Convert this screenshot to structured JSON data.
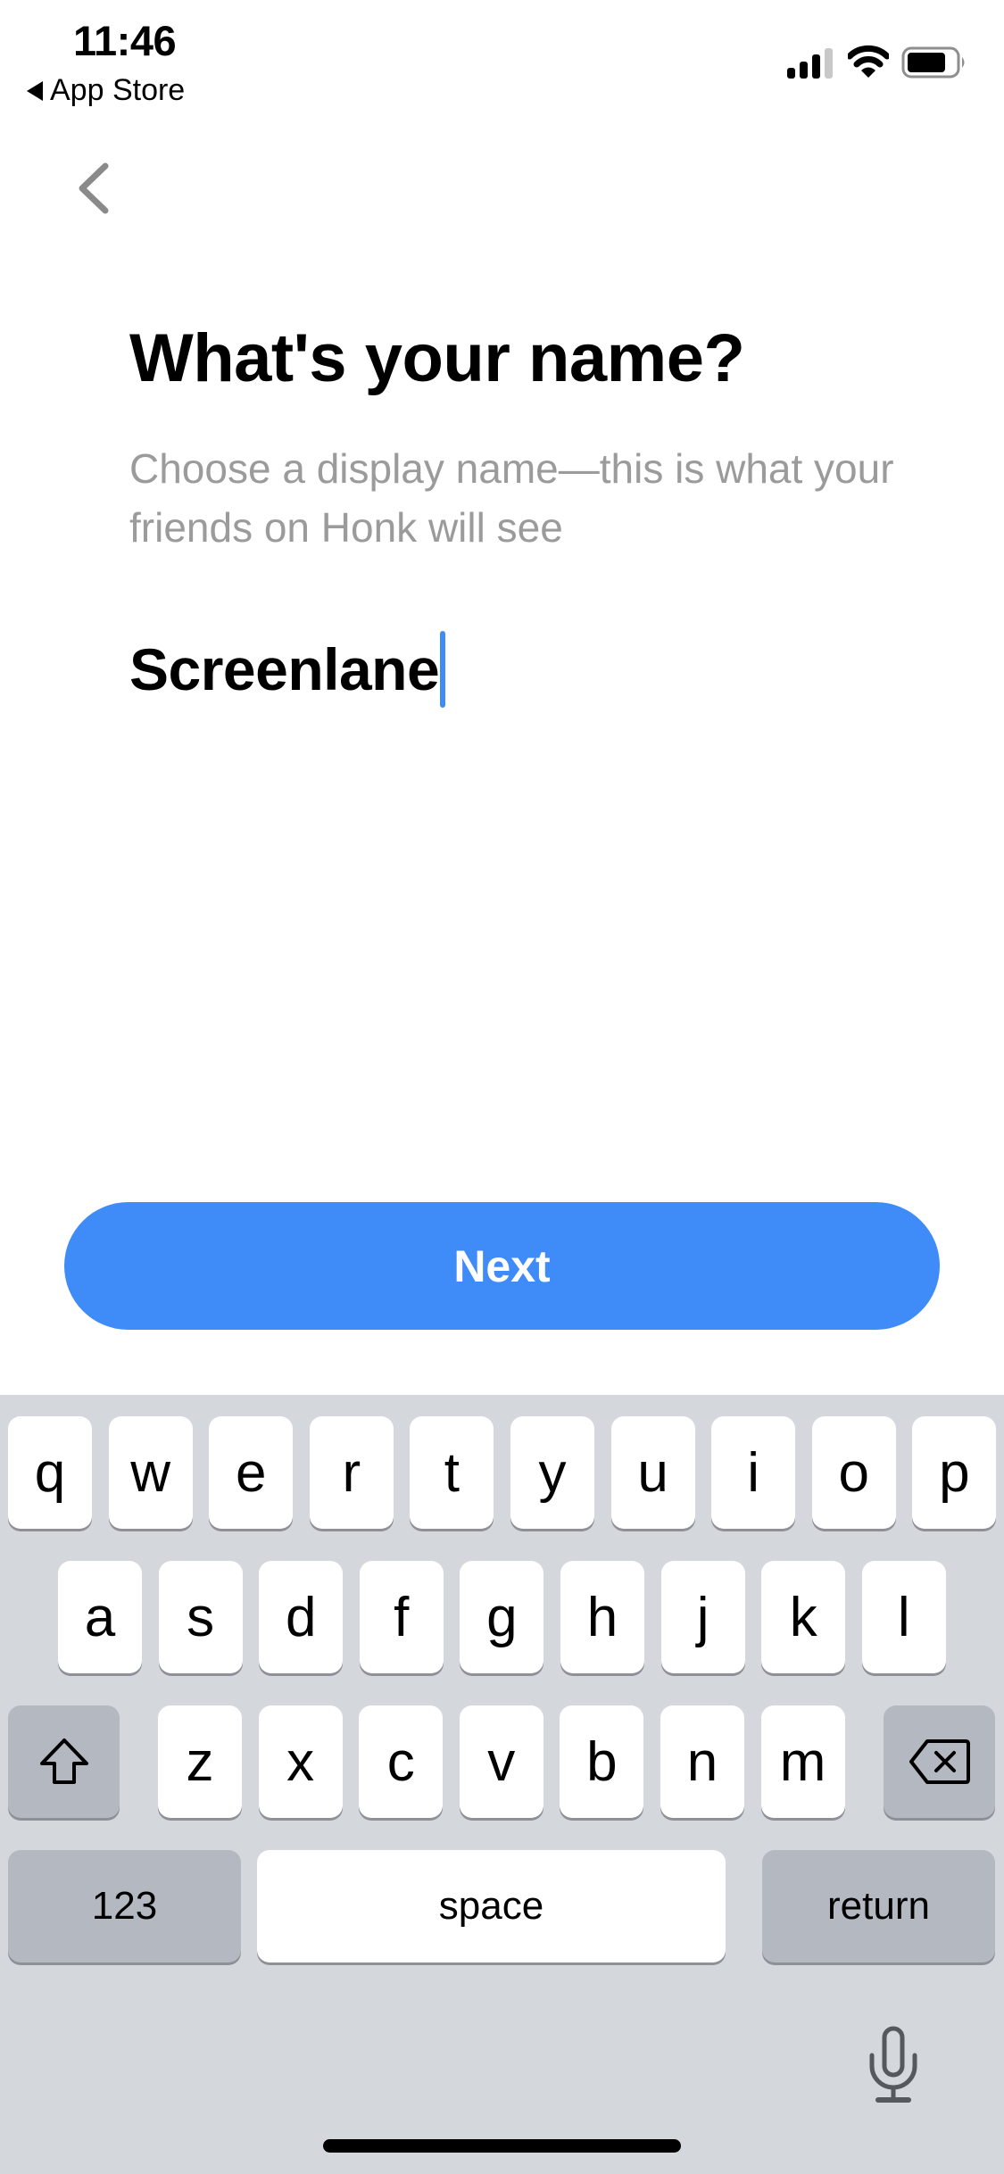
{
  "status_bar": {
    "time": "11:46",
    "back_app_label": "App Store",
    "signal_bars_filled": 3,
    "signal_bars_total": 4,
    "battery_level": 0.8
  },
  "nav": {
    "back_icon": "chevron-left-icon"
  },
  "main": {
    "title": "What's your name?",
    "subtitle": "Choose a display name—this is what your friends on Honk will see",
    "name_input_value": "Screenlane",
    "next_label": "Next"
  },
  "keyboard": {
    "row1": [
      "q",
      "w",
      "e",
      "r",
      "t",
      "y",
      "u",
      "i",
      "o",
      "p"
    ],
    "row2": [
      "a",
      "s",
      "d",
      "f",
      "g",
      "h",
      "j",
      "k",
      "l"
    ],
    "row3": [
      "z",
      "x",
      "c",
      "v",
      "b",
      "n",
      "m"
    ],
    "numbers_label": "123",
    "space_label": "space",
    "return_label": "return",
    "shift_icon": "shift-icon",
    "delete_icon": "delete-backspace-icon",
    "mic_icon": "microphone-icon"
  },
  "colors": {
    "accent": "#3f8bf7",
    "subtitle": "#9b9b9b",
    "keyboard_bg": "#d4d7dc",
    "function_key": "#b3b8c1"
  }
}
